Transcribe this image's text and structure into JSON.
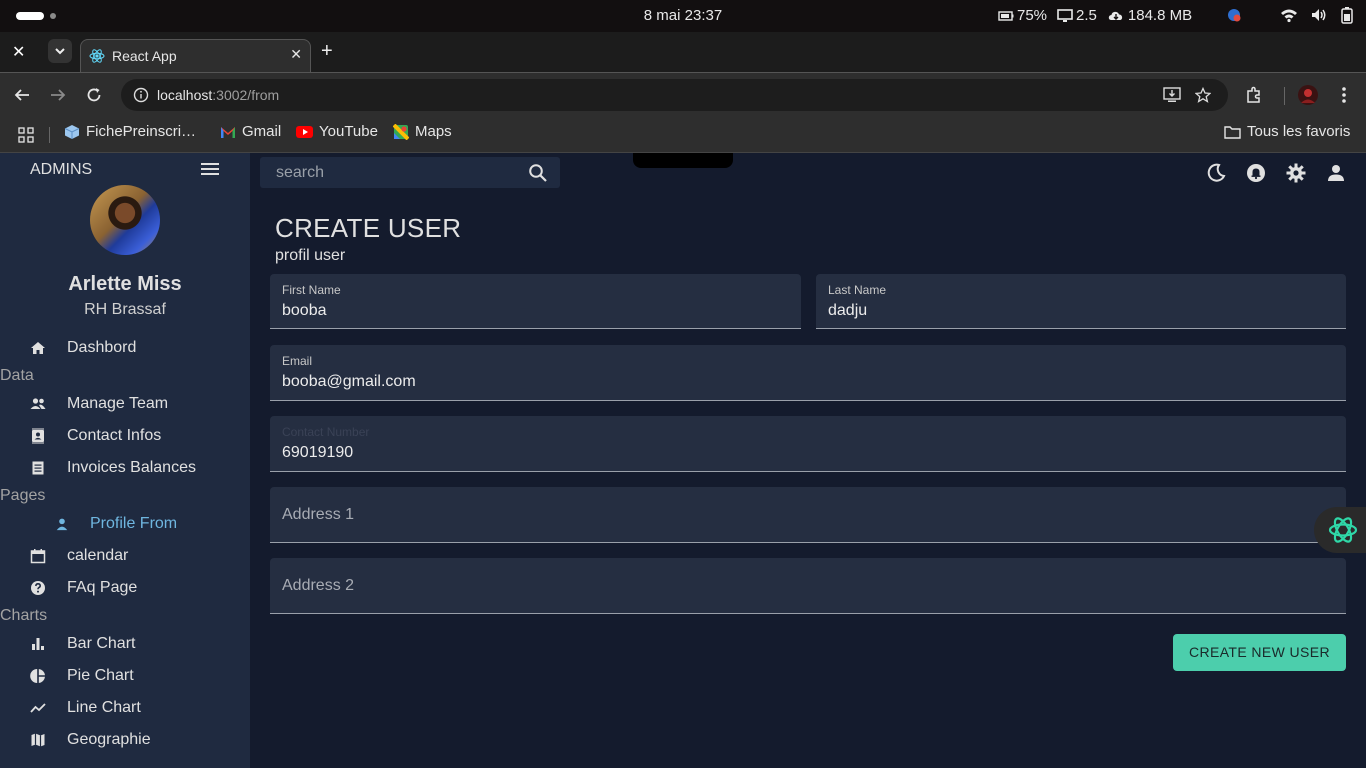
{
  "os": {
    "clock": "8 mai  23:37",
    "battery": "75%",
    "load": "2.5",
    "memory": "184.8 MB"
  },
  "browser": {
    "tab_title": "React App",
    "url_host": "localhost",
    "url_rest": ":3002/from",
    "bookmarks": [
      "FichePreinscri…",
      "Gmail",
      "YouTube",
      "Maps"
    ],
    "all_bookmarks": "Tous les favoris"
  },
  "sidebar": {
    "brand": "ADMINS",
    "user_name": "Arlette Miss",
    "user_role": "RH Brassaf",
    "items": {
      "dashboard": "Dashbord",
      "section_data": "Data",
      "manage_team": "Manage Team",
      "contact_infos": "Contact Infos",
      "invoices": "Invoices Balances",
      "section_pages": "Pages",
      "profile_from": "Profile From",
      "calendar": "calendar",
      "faq": "FAq Page",
      "section_charts": "Charts",
      "bar_chart": "Bar Chart",
      "pie_chart": "Pie Chart",
      "line_chart": "Line Chart",
      "geographie": "Geographie"
    }
  },
  "topbar": {
    "search_placeholder": "search"
  },
  "header": {
    "title": "CREATE USER",
    "subtitle": "profil user"
  },
  "form": {
    "first_name_label": "First Name",
    "first_name_value": "booba",
    "last_name_label": "Last Name",
    "last_name_value": "dadju",
    "email_label": "Email",
    "email_value": "booba@gmail.com",
    "contact_label": "Contact Number",
    "contact_value": "69019190",
    "address1_placeholder": "Address 1",
    "address2_placeholder": "Address 2",
    "submit_label": "CREATE NEW USER"
  },
  "colors": {
    "background": "#141b2d",
    "sidebar": "#1f2a40",
    "accent": "#4cceac",
    "active_item": "#6fb6e0"
  }
}
